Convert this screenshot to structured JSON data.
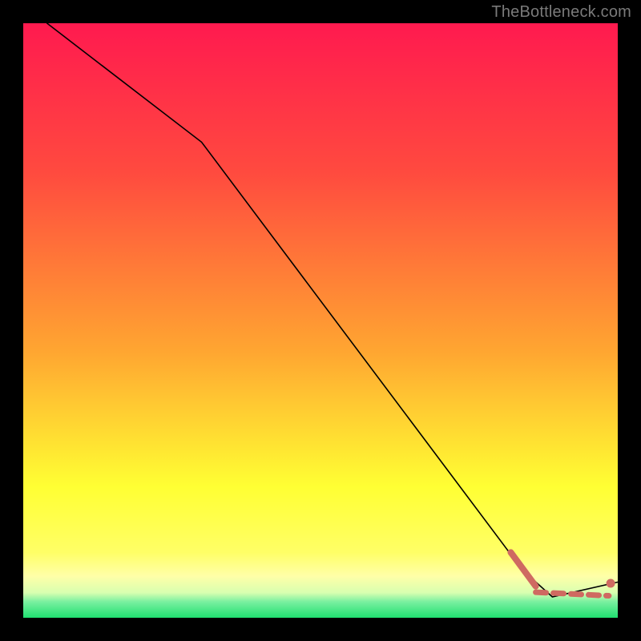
{
  "watermark": "TheBottleneck.com",
  "colors": {
    "bg": "#000000",
    "watermark": "#7a7a7a",
    "line_main": "#000000",
    "line_accent": "#cf6a61",
    "marker": "#cf6a61",
    "grad_top": "#ff1a4f",
    "grad_mid1": "#ff6a3a",
    "grad_mid2": "#ffd21a",
    "grad_yellow": "#ffff33",
    "grad_pale": "#ffffa8",
    "grad_green": "#20e070"
  },
  "chart_data": {
    "type": "line",
    "title": "",
    "xlabel": "",
    "ylabel": "",
    "xlim": [
      0,
      100
    ],
    "ylim": [
      0,
      100
    ],
    "series": [
      {
        "name": "main-curve",
        "style": "solid-thin-black",
        "x": [
          4,
          30,
          84,
          89,
          100
        ],
        "y": [
          100,
          80,
          8,
          3.5,
          6
        ]
      },
      {
        "name": "accent-tail-thick",
        "style": "solid-thick-accent",
        "x": [
          82,
          86.2
        ],
        "y": [
          11,
          5.3
        ]
      },
      {
        "name": "accent-flat-dashed",
        "style": "dashed-thick-accent",
        "x": [
          86.2,
          98.5
        ],
        "y": [
          4.3,
          3.7
        ]
      }
    ],
    "markers": [
      {
        "x": 98.8,
        "y": 5.8
      }
    ]
  }
}
